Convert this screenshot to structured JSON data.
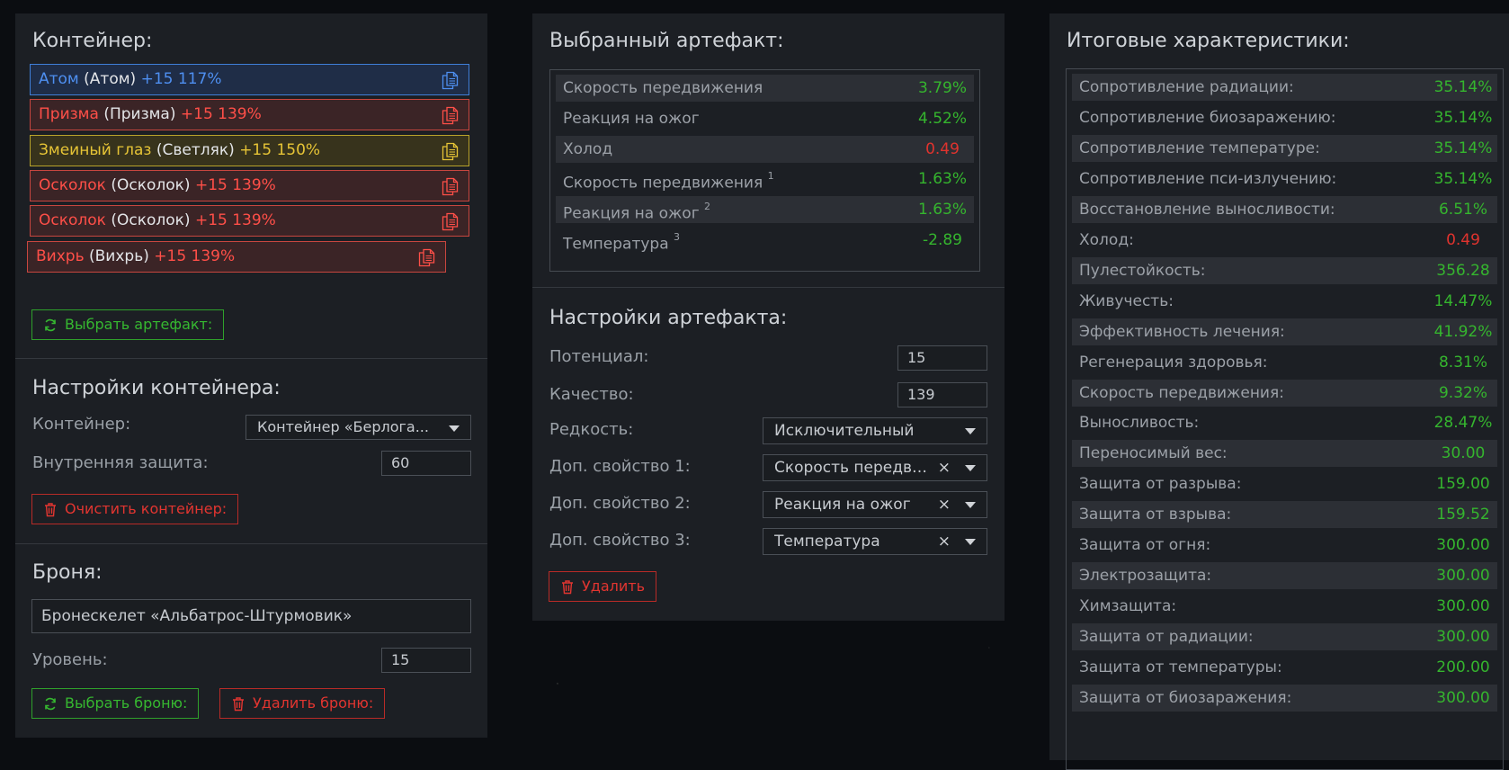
{
  "container_panel": {
    "title": "Контейнер:",
    "slots": [
      {
        "name": "Атом",
        "type": "(Атом)",
        "level": "+15 117%",
        "color": "#4e8ff0"
      },
      {
        "name": "Призма",
        "type": "(Призма)",
        "level": "+15 139%",
        "color": "#ff4f48"
      },
      {
        "name": "Змеиный глаз",
        "type": "(Светляк)",
        "level": "+15 150%",
        "color": "#e6c436"
      },
      {
        "name": "Осколок",
        "type": "(Осколок)",
        "level": "+15 139%",
        "color": "#ff4f48"
      },
      {
        "name": "Осколок",
        "type": "(Осколок)",
        "level": "+15 139%",
        "color": "#ff4f48"
      },
      {
        "name": "Вихрь",
        "type": "(Вихрь)",
        "level": "+15 139%",
        "color": "#ff4f48"
      }
    ],
    "select_button": "Выбрать артефакт:"
  },
  "container_settings": {
    "title": "Настройки контейнера:",
    "container_label": "Контейнер:",
    "container_value": "Контейнер «Берлога...",
    "inner_protection_label": "Внутренняя защита:",
    "inner_protection_value": "60",
    "clear_button": "Очистить контейнер:"
  },
  "armor": {
    "title": "Броня:",
    "armor_value": "Бронескелет «Альбатрос-Штурмовик»",
    "level_label": "Уровень:",
    "level_value": "15",
    "select_button": "Выбрать броню:",
    "delete_button": "Удалить броню:"
  },
  "selected_artifact": {
    "title": "Выбранный артефакт:",
    "stats": [
      {
        "name": "Скорость передвижения",
        "sup": "",
        "value": "3.79%",
        "sign": "pos"
      },
      {
        "name": "Реакция на ожог",
        "sup": "",
        "value": "4.52%",
        "sign": "pos"
      },
      {
        "name": "Холод",
        "sup": "",
        "value": "0.49",
        "sign": "neg"
      },
      {
        "name": "Скорость передвижения",
        "sup": "1",
        "value": "1.63%",
        "sign": "pos"
      },
      {
        "name": "Реакция на ожог",
        "sup": "2",
        "value": "1.63%",
        "sign": "pos"
      },
      {
        "name": "Температура",
        "sup": "3",
        "value": "-2.89",
        "sign": "pos"
      }
    ]
  },
  "artifact_settings": {
    "title": "Настройки артефакта:",
    "potential_label": "Потенциал:",
    "potential_value": "15",
    "quality_label": "Качество:",
    "quality_value": "139",
    "rarity_label": "Редкость:",
    "rarity_value": "Исключительный",
    "extra1_label": "Доп. свойство 1:",
    "extra1_value": "Скорость передвижения",
    "extra2_label": "Доп. свойство 2:",
    "extra2_value": "Реакция на ожог",
    "extra3_label": "Доп. свойство 3:",
    "extra3_value": "Температура",
    "clear_symbol": "×",
    "delete_button": "Удалить"
  },
  "totals": {
    "title": "Итоговые характеристики:",
    "stats": [
      {
        "name": "Сопротивление радиации:",
        "value": "35.14%",
        "sign": "pos"
      },
      {
        "name": "Сопротивление биозаражению:",
        "value": "35.14%",
        "sign": "pos"
      },
      {
        "name": "Сопротивление температуре:",
        "value": "35.14%",
        "sign": "pos"
      },
      {
        "name": "Сопротивление пси-излучению:",
        "value": "35.14%",
        "sign": "pos"
      },
      {
        "name": "Восстановление выносливости:",
        "value": "6.51%",
        "sign": "pos"
      },
      {
        "name": "Холод:",
        "value": "0.49",
        "sign": "neg"
      },
      {
        "name": "Пулестойкость:",
        "value": "356.28",
        "sign": "pos"
      },
      {
        "name": "Живучесть:",
        "value": "14.47%",
        "sign": "pos"
      },
      {
        "name": "Эффективность лечения:",
        "value": "41.92%",
        "sign": "pos"
      },
      {
        "name": "Регенерация здоровья:",
        "value": "8.31%",
        "sign": "pos"
      },
      {
        "name": "Скорость передвижения:",
        "value": "9.32%",
        "sign": "pos"
      },
      {
        "name": "Выносливость:",
        "value": "28.47%",
        "sign": "pos"
      },
      {
        "name": "Переносимый вес:",
        "value": "30.00",
        "sign": "pos"
      },
      {
        "name": "Защита от разрыва:",
        "value": "159.00",
        "sign": "pos"
      },
      {
        "name": "Защита от взрыва:",
        "value": "159.52",
        "sign": "pos"
      },
      {
        "name": "Защита от огня:",
        "value": "300.00",
        "sign": "pos"
      },
      {
        "name": "Электрозащита:",
        "value": "300.00",
        "sign": "pos"
      },
      {
        "name": "Химзащита:",
        "value": "300.00",
        "sign": "pos"
      },
      {
        "name": "Защита от радиации:",
        "value": "300.00",
        "sign": "pos"
      },
      {
        "name": "Защита от температуры:",
        "value": "200.00",
        "sign": "pos"
      },
      {
        "name": "Защита от биозаражения:",
        "value": "300.00",
        "sign": "pos"
      }
    ]
  }
}
